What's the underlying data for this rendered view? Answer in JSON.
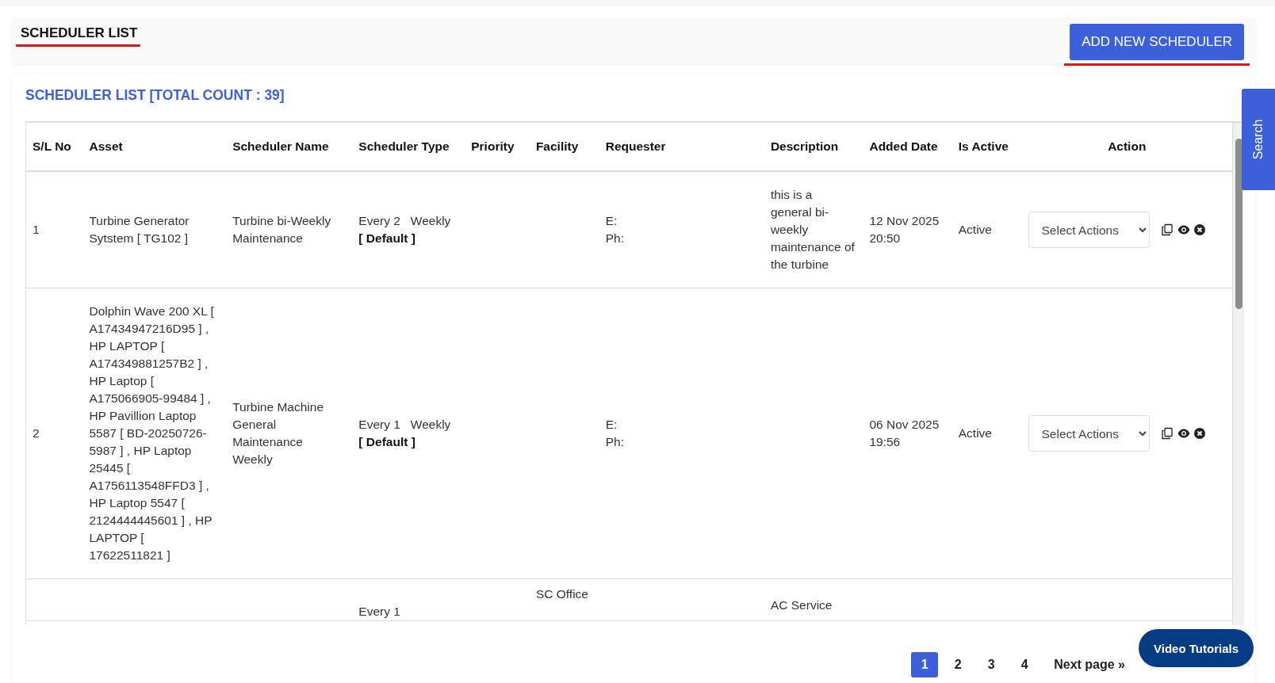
{
  "header": {
    "title": "SCHEDULER LIST",
    "add_button": "ADD NEW SCHEDULER"
  },
  "list": {
    "heading": "SCHEDULER LIST [TOTAL COUNT : 39]",
    "columns": [
      "S/L No",
      "Asset",
      "Scheduler Name",
      "Scheduler Type",
      "Priority",
      "Facility",
      "Requester",
      "Description",
      "Added Date",
      "Is Active",
      "Action"
    ],
    "rows": [
      {
        "sl": "1",
        "asset": "Turbine Generator Sytstem [ TG102 ]",
        "name": "Turbine bi-Weekly Maintenance",
        "every": "Every 2",
        "frequency": "Weekly",
        "tag": "[ Default ]",
        "facility": "",
        "requester": [
          "E:",
          "Ph:"
        ],
        "description": "this is a general bi-weekly maintenance of the turbine",
        "added": "12 Nov 2025 20:50",
        "active": "Active",
        "action_placeholder": "Select Actions"
      },
      {
        "sl": "2",
        "asset": "Dolphin Wave 200 XL [ A17434947216D95 ] , HP LAPTOP [ A174349881257B2 ] , HP Laptop [ A175066905-99484 ] , HP Pavillion Laptop 5587 [ BD-20250726-5987 ] , HP Laptop 25445 [ A1756113548FFD3 ] , HP Laptop 5547 [ 2124444445601 ] , HP LAPTOP [ 17622511821 ]",
        "name": "Turbine Machine General Maintenance Weekly",
        "every": "Every 1",
        "frequency": "Weekly",
        "tag": "[ Default ]",
        "facility": "",
        "requester": [
          "E:",
          "Ph:"
        ],
        "description": "",
        "added": "06 Nov 2025 19:56",
        "active": "Active",
        "action_placeholder": "Select Actions"
      },
      {
        "partial": true,
        "every": "Every 1",
        "facility": "SC Office",
        "description": "AC Service"
      }
    ]
  },
  "pagination": {
    "pages": [
      {
        "label": "1",
        "selected": true
      },
      {
        "label": "2",
        "selected": false
      },
      {
        "label": "3",
        "selected": false
      },
      {
        "label": "4",
        "selected": false
      }
    ],
    "next": "Next page »"
  },
  "search_tab": "Search",
  "video_button": "Video Tutorials"
}
